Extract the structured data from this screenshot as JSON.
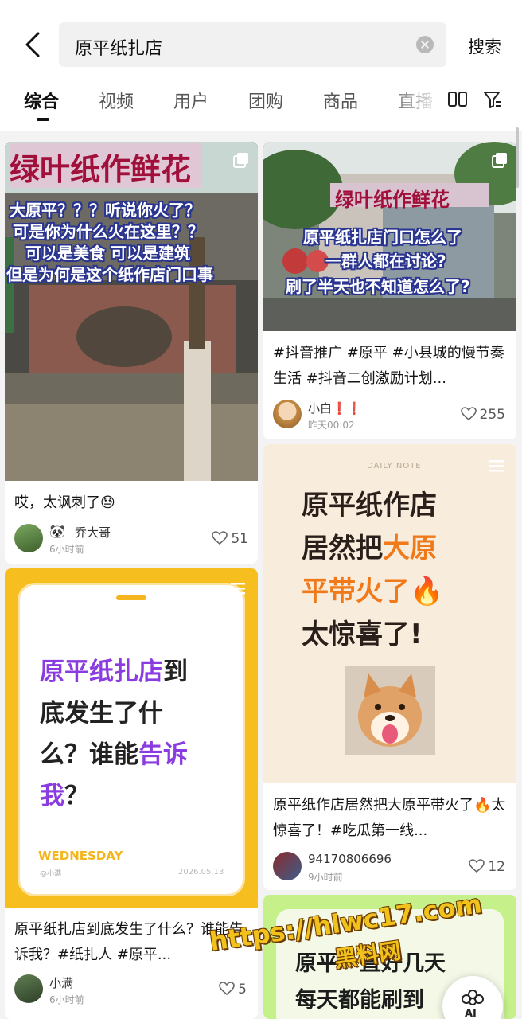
{
  "search": {
    "query": "原平纸扎店",
    "submit_label": "搜索"
  },
  "tabs": [
    {
      "label": "综合",
      "active": true
    },
    {
      "label": "视频"
    },
    {
      "label": "用户"
    },
    {
      "label": "团购"
    },
    {
      "label": "商品"
    },
    {
      "label": "直播"
    }
  ],
  "toolbar_icons": [
    "grid-view-icon",
    "filter-icon"
  ],
  "feed": {
    "card1": {
      "cover_caption": [
        "大原平？？？听说你火了？",
        "可是你为什么火在这里？？",
        "可以是美食 可以是建筑",
        "但是为何是这个纸作店门口事"
      ],
      "sign_text": "绿叶纸作鲜花",
      "title": "哎，太讽刺了😓",
      "author": "乔大哥",
      "author_emoji": "🐼",
      "time": "6小时前",
      "likes": "51"
    },
    "card2": {
      "cover_caption": [
        "原平纸扎店门口怎么了",
        "一群人都在讨论?",
        "刷了半天也不知道怎么了?"
      ],
      "sign_text": "绿叶纸作鲜花",
      "title": "#抖音推广 #原平 #小县城的慢节奏生活 #抖音二创激励计划...",
      "author": "小白❗❗",
      "time": "昨天00:02",
      "likes": "255"
    },
    "card3": {
      "cover_lines": [
        "原平纸扎店到",
        "底发生了什",
        "么？谁能告诉",
        "我？"
      ],
      "cover_day": "WEDNESDAY",
      "cover_handle": "@小满",
      "cover_date": "2026.05.13",
      "title": "原平纸扎店到底发生了什么？谁能告诉我？#纸扎人 #原平...",
      "author": "小满",
      "time": "6小时前",
      "likes": "5"
    },
    "card4": {
      "cover_header": "DAILY NOTE",
      "cover_lines": [
        "原平纸作店",
        "居然把大原",
        "平带火了🔥",
        "太惊喜了!"
      ],
      "title": "原平纸作店居然把大原平带火了🔥太惊喜了！#吃瓜第一线...",
      "author": "94170806696",
      "time": "9小时前",
      "likes": "12"
    },
    "card5": {
      "cover_lines": [
        "原平一直好几天",
        "每天都能刷到"
      ]
    }
  },
  "overlay": {
    "watermark_url": "https://hlwc17.com",
    "watermark_name": "黑料网",
    "ai_label": "AI"
  },
  "colors": {
    "purple_accent": "#8a3ce0",
    "orange_accent": "#f07a1a",
    "yellow_frame": "#f7be1f",
    "green_cover": "#c6f08a"
  }
}
